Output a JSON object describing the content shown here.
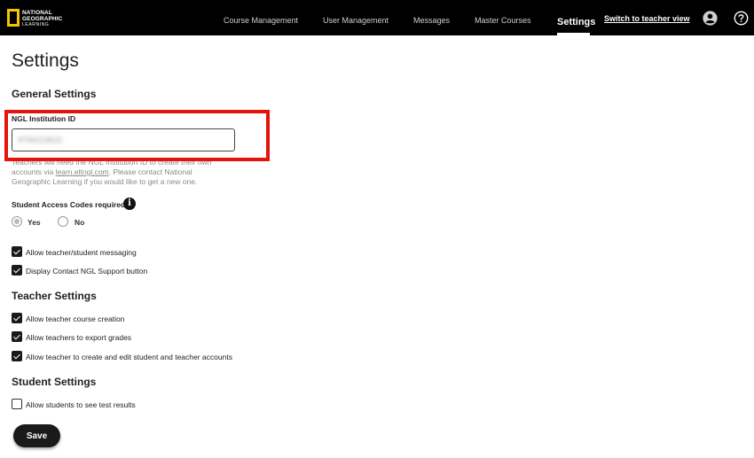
{
  "brand": {
    "logo_line1": "NATIONAL",
    "logo_line2": "GEOGRAPHIC",
    "logo_line3": "LEARNING",
    "accent": "#f5c400"
  },
  "nav": {
    "items": [
      {
        "label": "Course Management"
      },
      {
        "label": "User Management"
      },
      {
        "label": "Messages"
      },
      {
        "label": "Master Courses"
      }
    ],
    "active": "Settings",
    "switch_link": "Switch to teacher view",
    "icons": [
      "user-account-icon",
      "help-icon"
    ]
  },
  "page": {
    "title": "Settings"
  },
  "general": {
    "heading": "General Settings",
    "institution_label": "NGL Institution ID",
    "institution_value": "9756223622",
    "helper_line1": "Teachers will need the NGL Institution ID to create their own",
    "helper_prefix": "accounts via ",
    "helper_link": "learn.eltngl.com",
    "helper_suffix": ". Please contact National",
    "helper_line3": "Geographic Learning if you would like to get a new one.",
    "access_codes_label": "Student Access Codes required",
    "info_glyph": "i",
    "radio_yes": "Yes",
    "radio_no": "No",
    "selected": "Yes",
    "options": [
      {
        "label": "Allow teacher/student messaging",
        "checked": true
      },
      {
        "label": "Display Contact NGL Support button",
        "checked": true
      }
    ]
  },
  "teacher": {
    "heading": "Teacher Settings",
    "options": [
      {
        "label": "Allow teacher course creation",
        "checked": true
      },
      {
        "label": "Allow teachers to export grades",
        "checked": true
      },
      {
        "label": "Allow teacher to create and edit student and teacher accounts",
        "checked": true
      }
    ]
  },
  "student": {
    "heading": "Student Settings",
    "options": [
      {
        "label": "Allow students to see test results",
        "checked": false
      }
    ]
  },
  "actions": {
    "save_label": "Save"
  },
  "colors": {
    "topbar": "#000000",
    "highlight": "#e8120c"
  }
}
